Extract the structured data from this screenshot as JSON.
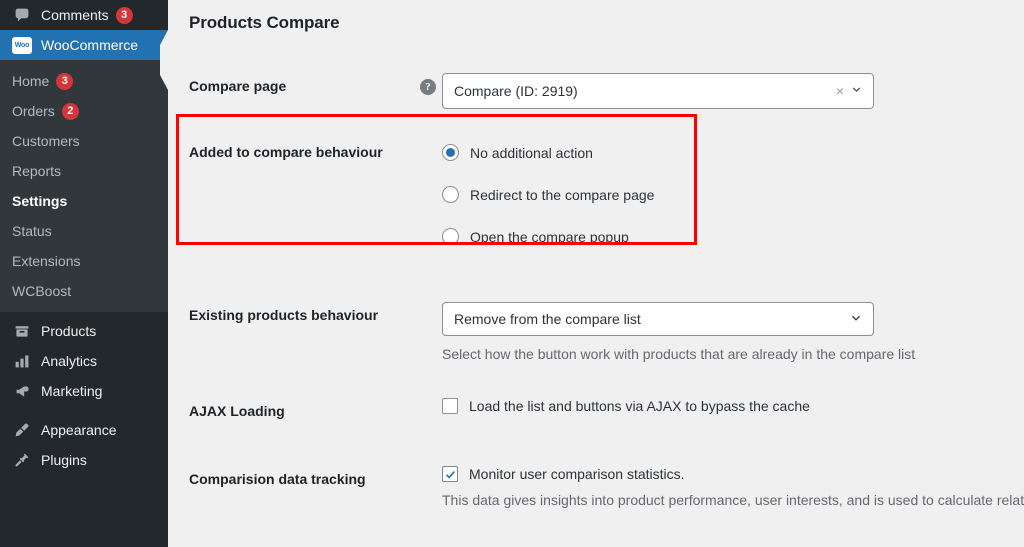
{
  "sidebar": {
    "top_items": [
      {
        "label": "Comments",
        "icon": "comments-icon",
        "badge": "3",
        "current": false
      }
    ],
    "current_item": {
      "label": "WooCommerce",
      "icon": "woocommerce-icon",
      "badge_text": "Woo"
    },
    "submenu": [
      {
        "label": "Home",
        "badge": "3",
        "active": false
      },
      {
        "label": "Orders",
        "badge": "2",
        "active": false
      },
      {
        "label": "Customers",
        "badge": "",
        "active": false
      },
      {
        "label": "Reports",
        "badge": "",
        "active": false
      },
      {
        "label": "Settings",
        "badge": "",
        "active": true
      },
      {
        "label": "Status",
        "badge": "",
        "active": false
      },
      {
        "label": "Extensions",
        "badge": "",
        "active": false
      },
      {
        "label": "WCBoost",
        "badge": "",
        "active": false
      }
    ],
    "bottom_items": [
      {
        "label": "Products",
        "icon": "products-icon"
      },
      {
        "label": "Analytics",
        "icon": "analytics-icon"
      },
      {
        "label": "Marketing",
        "icon": "marketing-icon"
      },
      {
        "label": "Appearance",
        "icon": "appearance-icon"
      },
      {
        "label": "Plugins",
        "icon": "plugins-icon"
      }
    ]
  },
  "page": {
    "title": "Products Compare"
  },
  "settings": {
    "compare_page": {
      "label": "Compare page",
      "help_icon": "help-icon",
      "value": "Compare (ID: 2919)",
      "clear_icon": "×",
      "arrow_icon": "⌄"
    },
    "added_behaviour": {
      "label": "Added to compare behaviour",
      "options": [
        {
          "label": "No additional action",
          "checked": true
        },
        {
          "label": "Redirect to the compare page",
          "checked": false
        },
        {
          "label": "Open the compare popup",
          "checked": false
        }
      ]
    },
    "existing_behaviour": {
      "label": "Existing products behaviour",
      "value": "Remove from the compare list",
      "arrow_icon": "⌄",
      "description": "Select how the button work with products that are already in the compare list"
    },
    "ajax_loading": {
      "label": "AJAX Loading",
      "option_label": "Load the list and buttons via AJAX to bypass the cache",
      "checked": false
    },
    "data_tracking": {
      "label": "Comparision data tracking",
      "option_label": "Monitor user comparison statistics.",
      "checked": true,
      "description": "This data gives insights into product performance, user interests, and is used to calculate related data to products."
    }
  },
  "annotation": {
    "color": "#ff0000",
    "target": "added-to-compare-behaviour"
  }
}
